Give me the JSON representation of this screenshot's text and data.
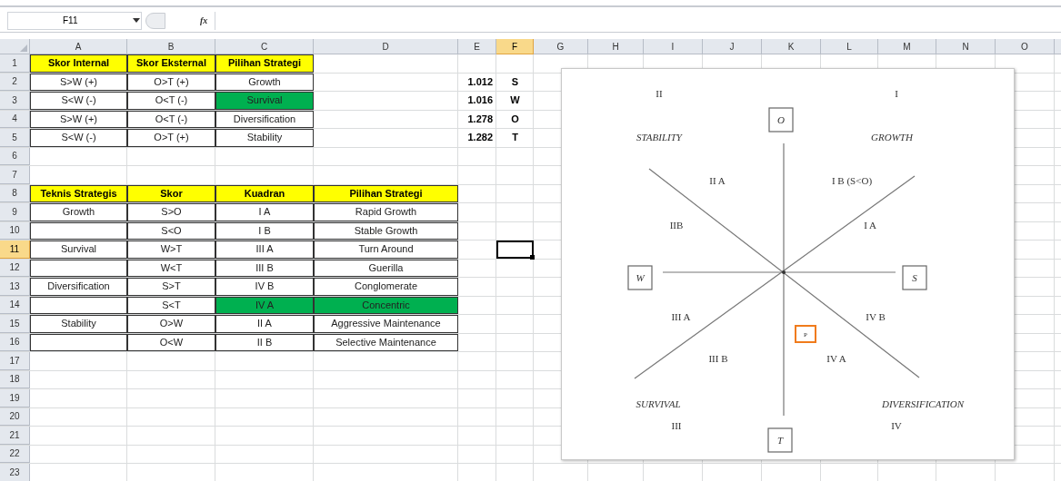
{
  "formula_bar": {
    "name_box": "F11",
    "fx_label": "fx"
  },
  "columns": [
    {
      "label": "A",
      "selected": false
    },
    {
      "label": "B",
      "selected": false
    },
    {
      "label": "C",
      "selected": false
    },
    {
      "label": "D",
      "selected": false
    },
    {
      "label": "E",
      "selected": false
    },
    {
      "label": "F",
      "selected": true
    },
    {
      "label": "G",
      "selected": false
    },
    {
      "label": "H",
      "selected": false
    },
    {
      "label": "I",
      "selected": false
    },
    {
      "label": "J",
      "selected": false
    },
    {
      "label": "K",
      "selected": false
    },
    {
      "label": "L",
      "selected": false
    },
    {
      "label": "M",
      "selected": false
    },
    {
      "label": "N",
      "selected": false
    },
    {
      "label": "O",
      "selected": false
    }
  ],
  "rows": [
    {
      "number": "1",
      "selected": false,
      "cells": [
        {
          "kind": "header",
          "text": "Skor Internal"
        },
        {
          "kind": "header",
          "text": "Skor Eksternal"
        },
        {
          "kind": "header",
          "text": "Pilihan Strategi"
        }
      ]
    },
    {
      "number": "2",
      "selected": false,
      "cells": [
        {
          "kind": "data",
          "text": "S>W (+)",
          "highlighted": false
        },
        {
          "kind": "data",
          "text": "O>T (+)",
          "highlighted": false
        },
        {
          "kind": "data",
          "text": "Growth",
          "highlighted": false
        },
        {
          "kind": "empty"
        },
        {
          "kind": "number",
          "text": "1.012"
        },
        {
          "kind": "letter",
          "text": "S"
        }
      ]
    },
    {
      "number": "3",
      "selected": false,
      "cells": [
        {
          "kind": "data",
          "text": "S<W (-)",
          "highlighted": false
        },
        {
          "kind": "data",
          "text": "O<T (-)",
          "highlighted": false
        },
        {
          "kind": "data",
          "text": "Survival",
          "highlighted": true
        },
        {
          "kind": "empty"
        },
        {
          "kind": "number",
          "text": "1.016"
        },
        {
          "kind": "letter",
          "text": "W"
        }
      ]
    },
    {
      "number": "4",
      "selected": false,
      "cells": [
        {
          "kind": "data",
          "text": "S>W (+)",
          "highlighted": false
        },
        {
          "kind": "data",
          "text": "O<T (-)",
          "highlighted": false
        },
        {
          "kind": "data",
          "text": "Diversification",
          "highlighted": false
        },
        {
          "kind": "empty"
        },
        {
          "kind": "number",
          "text": "1.278"
        },
        {
          "kind": "letter",
          "text": "O"
        }
      ]
    },
    {
      "number": "5",
      "selected": false,
      "cells": [
        {
          "kind": "data",
          "text": "S<W (-)",
          "highlighted": false
        },
        {
          "kind": "data",
          "text": "O>T (+)",
          "highlighted": false
        },
        {
          "kind": "data",
          "text": "Stability",
          "highlighted": false
        },
        {
          "kind": "empty"
        },
        {
          "kind": "number",
          "text": "1.282"
        },
        {
          "kind": "letter",
          "text": "T"
        }
      ]
    },
    {
      "number": "6",
      "selected": false,
      "cells": []
    },
    {
      "number": "7",
      "selected": false,
      "cells": []
    },
    {
      "number": "8",
      "selected": false,
      "cells": [
        {
          "kind": "header",
          "text": "Teknis Strategis"
        },
        {
          "kind": "header",
          "text": "Skor"
        },
        {
          "kind": "header",
          "text": "Kuadran"
        },
        {
          "kind": "header",
          "text": "Pilihan Strategi"
        }
      ]
    },
    {
      "number": "9",
      "selected": false,
      "cells": [
        {
          "kind": "data",
          "text": "Growth",
          "highlighted": false
        },
        {
          "kind": "data",
          "text": "S>O",
          "highlighted": false
        },
        {
          "kind": "data",
          "text": "I A",
          "highlighted": false
        },
        {
          "kind": "data",
          "text": "Rapid Growth",
          "highlighted": false
        }
      ]
    },
    {
      "number": "10",
      "selected": false,
      "cells": [
        {
          "kind": "data",
          "highlighted": false
        },
        {
          "kind": "data",
          "text": "S<O",
          "highlighted": false
        },
        {
          "kind": "data",
          "text": "I B",
          "highlighted": false
        },
        {
          "kind": "data",
          "text": "Stable Growth",
          "highlighted": false
        }
      ]
    },
    {
      "number": "11",
      "selected": true,
      "cells": [
        {
          "kind": "data",
          "text": "Survival",
          "highlighted": false
        },
        {
          "kind": "data",
          "text": "W>T",
          "highlighted": false
        },
        {
          "kind": "data",
          "text": "III A",
          "highlighted": false
        },
        {
          "kind": "data",
          "text": "Turn Around",
          "highlighted": false
        },
        {
          "kind": "empty"
        },
        {
          "kind": "active"
        }
      ]
    },
    {
      "number": "12",
      "selected": false,
      "cells": [
        {
          "kind": "data",
          "highlighted": false
        },
        {
          "kind": "data",
          "text": "W<T",
          "highlighted": false
        },
        {
          "kind": "data",
          "text": "III B",
          "highlighted": false
        },
        {
          "kind": "data",
          "text": "Guerilla",
          "highlighted": false
        }
      ]
    },
    {
      "number": "13",
      "selected": false,
      "cells": [
        {
          "kind": "data",
          "text": "Diversification",
          "highlighted": false
        },
        {
          "kind": "data",
          "text": "S>T",
          "highlighted": false
        },
        {
          "kind": "data",
          "text": "IV B",
          "highlighted": false
        },
        {
          "kind": "data",
          "text": "Conglomerate",
          "highlighted": false
        }
      ]
    },
    {
      "number": "14",
      "selected": false,
      "cells": [
        {
          "kind": "data",
          "highlighted": false
        },
        {
          "kind": "data",
          "text": "S<T",
          "highlighted": false
        },
        {
          "kind": "data",
          "text": "IV A",
          "highlighted": true
        },
        {
          "kind": "data",
          "text": "Concentric",
          "highlighted": true
        }
      ]
    },
    {
      "number": "15",
      "selected": false,
      "cells": [
        {
          "kind": "data",
          "text": "Stability",
          "highlighted": false
        },
        {
          "kind": "data",
          "text": "O>W",
          "highlighted": false
        },
        {
          "kind": "data",
          "text": "II A",
          "highlighted": false
        },
        {
          "kind": "data",
          "text": "Aggressive Maintenance",
          "highlighted": false
        }
      ]
    },
    {
      "number": "16",
      "selected": false,
      "cells": [
        {
          "kind": "data",
          "highlighted": false
        },
        {
          "kind": "data",
          "text": "O<W",
          "highlighted": false
        },
        {
          "kind": "data",
          "text": "II B",
          "highlighted": false
        },
        {
          "kind": "data",
          "text": "Selective Maintenance",
          "highlighted": false
        }
      ]
    },
    {
      "number": "17",
      "selected": false,
      "cells": []
    },
    {
      "number": "18",
      "selected": false,
      "cells": []
    },
    {
      "number": "19",
      "selected": false,
      "cells": []
    },
    {
      "number": "20",
      "selected": false,
      "cells": []
    },
    {
      "number": "21",
      "selected": false,
      "cells": []
    },
    {
      "number": "22",
      "selected": false,
      "cells": []
    },
    {
      "number": "23",
      "selected": false,
      "cells": []
    }
  ],
  "diagram": {
    "labels": [
      {
        "kind": "numeral",
        "text": "II"
      },
      {
        "kind": "numeral",
        "text": "I"
      },
      {
        "kind": "strategy",
        "text": "STABILITY"
      },
      {
        "kind": "strategy",
        "text": "GROWTH"
      },
      {
        "kind": "axis",
        "text": "O"
      },
      {
        "kind": "numeral",
        "text": "II A"
      },
      {
        "kind": "numeral",
        "text": "I B (S<O)"
      },
      {
        "kind": "numeral",
        "text": "IIB"
      },
      {
        "kind": "numeral",
        "text": "I A"
      },
      {
        "kind": "axis",
        "text": "W"
      },
      {
        "kind": "axis",
        "text": "S"
      },
      {
        "kind": "numeral",
        "text": "III A"
      },
      {
        "kind": "numeral",
        "text": "IV B"
      },
      {
        "kind": "position",
        "text": "P"
      },
      {
        "kind": "numeral",
        "text": "III B"
      },
      {
        "kind": "numeral",
        "text": "IV A"
      },
      {
        "kind": "strategy",
        "text": "SURVIVAL"
      },
      {
        "kind": "strategy",
        "text": "DIVERSIFICATION"
      },
      {
        "kind": "numeral",
        "text": "III"
      },
      {
        "kind": "axis",
        "text": "T"
      },
      {
        "kind": "numeral",
        "text": "IV"
      }
    ]
  }
}
